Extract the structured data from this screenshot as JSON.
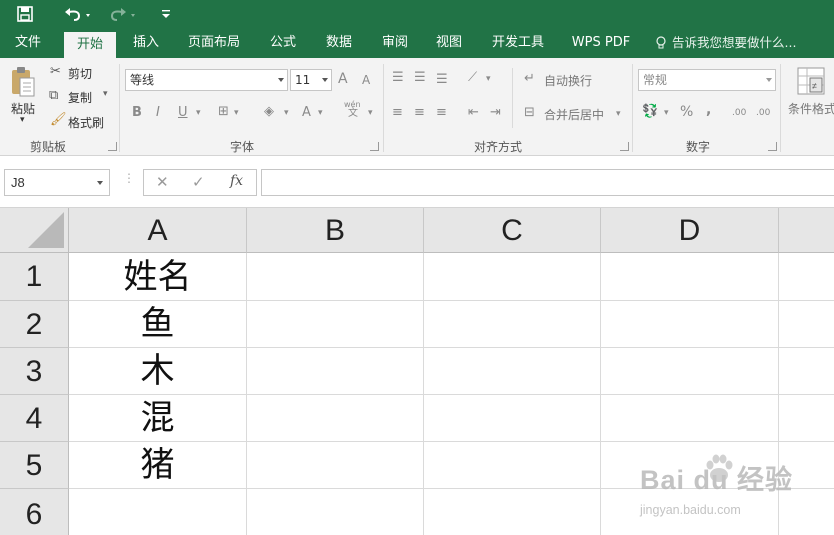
{
  "quick_access": {
    "icons": [
      "save-icon",
      "undo-icon",
      "redo-icon",
      "customize-icon"
    ]
  },
  "ribbon_tabs": [
    {
      "label": "文件"
    },
    {
      "label": "开始"
    },
    {
      "label": "插入"
    },
    {
      "label": "页面布局"
    },
    {
      "label": "公式"
    },
    {
      "label": "数据"
    },
    {
      "label": "审阅"
    },
    {
      "label": "视图"
    },
    {
      "label": "开发工具"
    },
    {
      "label": "WPS PDF"
    },
    {
      "label": "告诉我您想要做什么..."
    }
  ],
  "active_tab": "开始",
  "ribbon": {
    "clipboard": {
      "paste": "粘贴",
      "cut": "剪切",
      "copy": "复制",
      "format_painter": "格式刷",
      "group_label": "剪贴板"
    },
    "font": {
      "font_name": "等线",
      "font_size": "11",
      "bold": "B",
      "italic": "I",
      "underline": "U",
      "font_color": "A",
      "phonetic": "wén",
      "phonetic_char": "文",
      "grow": "A",
      "shrink": "A",
      "group_label": "字体"
    },
    "alignment": {
      "wrap_text": "自动换行",
      "merge_center": "合并后居中",
      "group_label": "对齐方式"
    },
    "number": {
      "format": "常规",
      "percent": "%",
      "comma": ",",
      "increase_decimal": ".00",
      "decrease_decimal": ".00",
      "group_label": "数字"
    },
    "styles": {
      "conditional_formatting": "条件格式"
    }
  },
  "formula_bar": {
    "name_box": "J8",
    "cancel": "✕",
    "enter": "✓",
    "function": "fx",
    "content": ""
  },
  "sheet": {
    "columns": [
      "A",
      "B",
      "C",
      "D"
    ],
    "rows": [
      "1",
      "2",
      "3",
      "4",
      "5",
      "6"
    ],
    "cells": {
      "A1": "姓名",
      "A2": "鱼",
      "A3": "木",
      "A4": "混",
      "A5": "猪"
    }
  },
  "watermark": {
    "brand": "Bai du 经验",
    "url": "jingyan.baidu.com"
  },
  "colors": {
    "ribbon_green": "#217346",
    "ribbon_body": "#f3f3f3",
    "header_gray": "#e6e6e6",
    "grid_line": "#dadada"
  }
}
